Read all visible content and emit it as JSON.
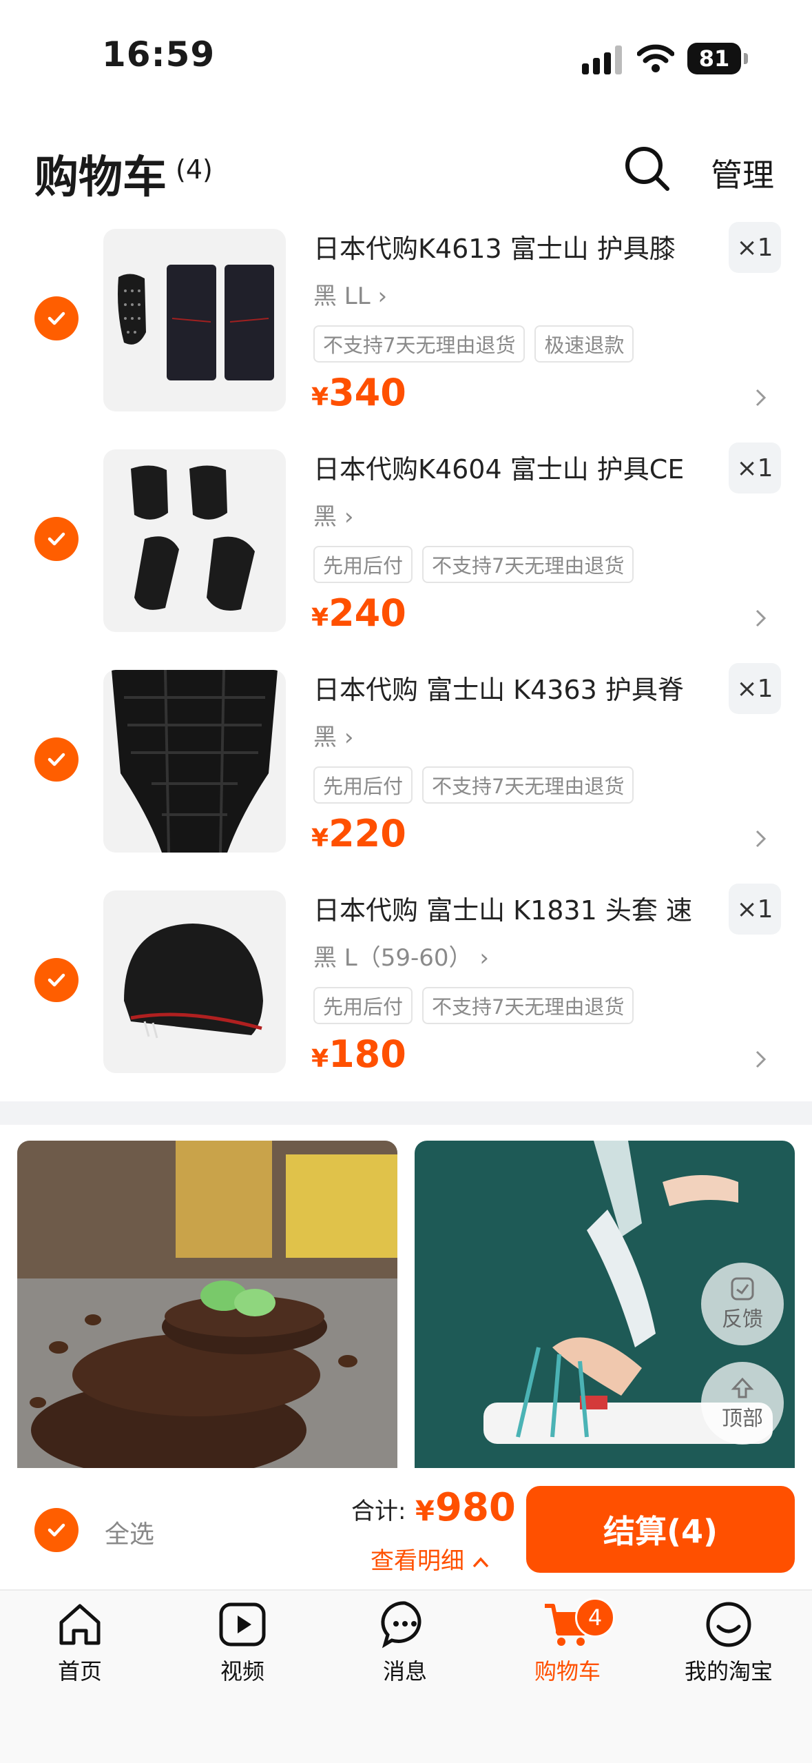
{
  "status_bar": {
    "time": "16:59",
    "battery": "81"
  },
  "header": {
    "title": "购物车",
    "count": "(4)",
    "manage_label": "管理"
  },
  "cart_items": [
    {
      "title": "日本代购K4613 富士山 护具膝",
      "variant": "黑 LL",
      "tags": [
        "不支持7天无理由退货",
        "极速退款"
      ],
      "price_symbol": "¥",
      "price": "340",
      "qty": "×1"
    },
    {
      "title": "日本代购K4604 富士山 护具CE",
      "variant": "黑",
      "tags": [
        "先用后付",
        "不支持7天无理由退货"
      ],
      "price_symbol": "¥",
      "price": "240",
      "qty": "×1"
    },
    {
      "title": "日本代购 富士山 K4363 护具脊",
      "variant": "黑",
      "tags": [
        "先用后付",
        "不支持7天无理由退货"
      ],
      "price_symbol": "¥",
      "price": "220",
      "qty": "×1"
    },
    {
      "title": "日本代购 富士山 K1831 头套 速",
      "variant": "黑 L（59-60）",
      "tags": [
        "先用后付",
        "不支持7天无理由退货"
      ],
      "price_symbol": "¥",
      "price": "180",
      "qty": "×1"
    }
  ],
  "floating": {
    "feedback_label": "反馈",
    "top_label": "顶部"
  },
  "checkout": {
    "select_all_label": "全选",
    "total_label": "合计:",
    "total_symbol": "¥",
    "total_value": "980",
    "detail_label": "查看明细",
    "checkout_label": "结算(4)"
  },
  "tabbar": {
    "items": [
      {
        "label": "首页"
      },
      {
        "label": "视频"
      },
      {
        "label": "消息"
      },
      {
        "label": "购物车"
      },
      {
        "label": "我的淘宝"
      }
    ],
    "cart_badge": "4"
  },
  "colors": {
    "accent": "#ff5000",
    "check": "#ff5e00"
  }
}
